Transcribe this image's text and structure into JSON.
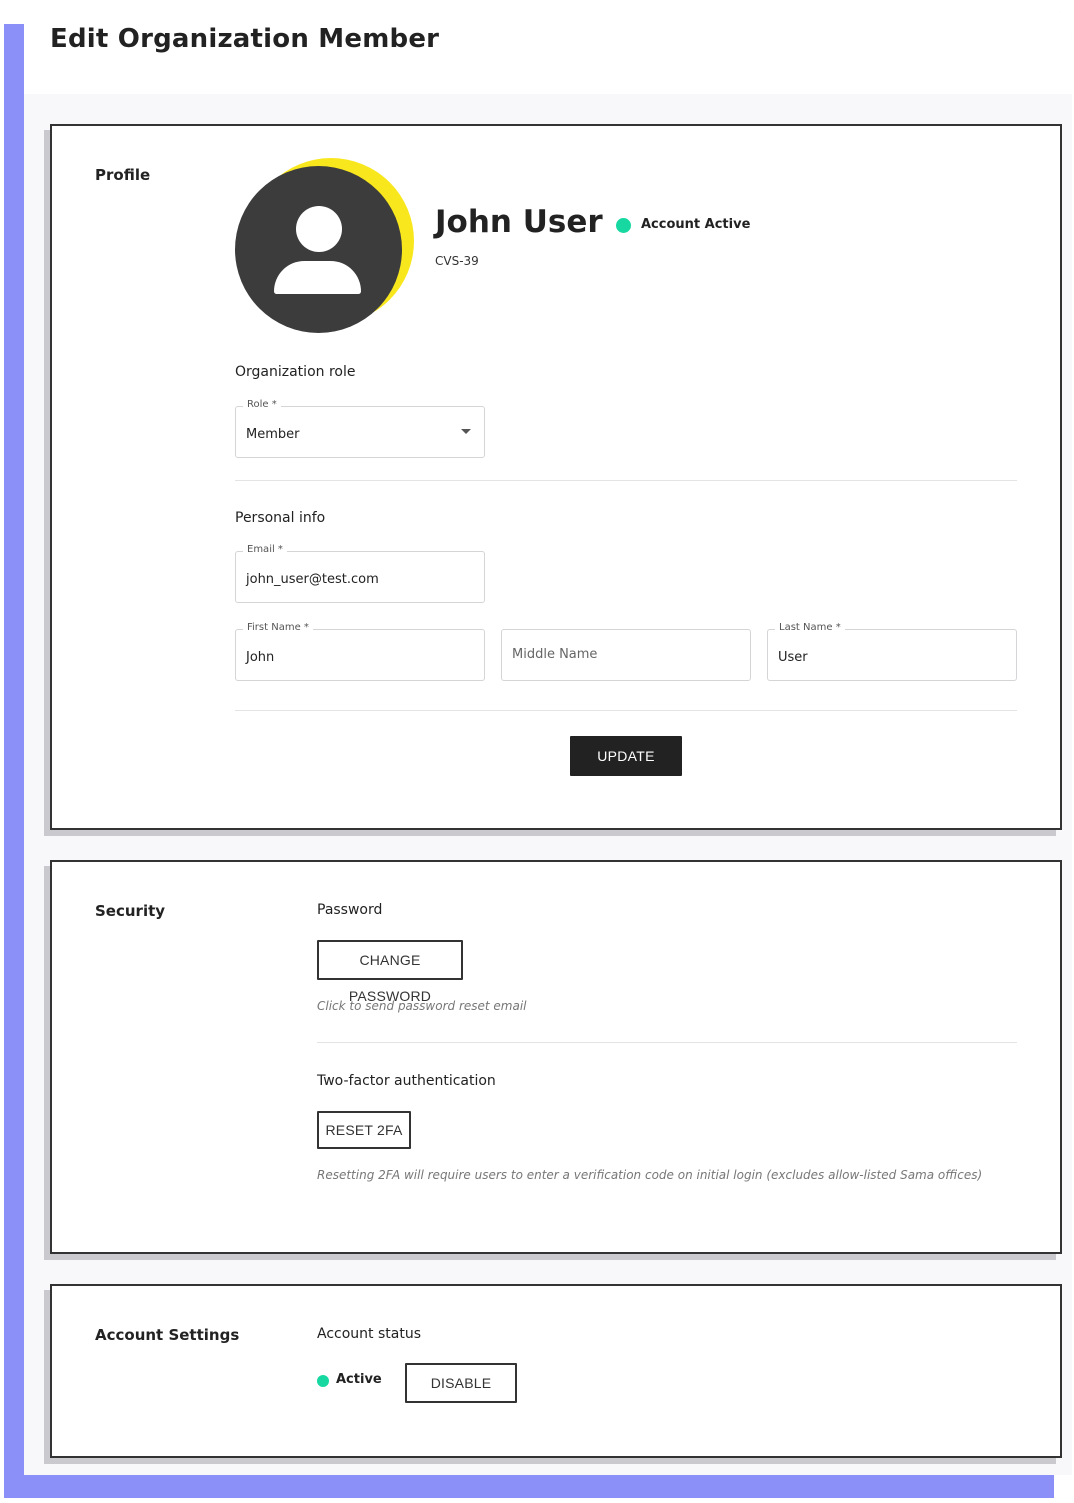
{
  "page": {
    "title": "Edit Organization Member"
  },
  "profile": {
    "section_label": "Profile",
    "name": "John User",
    "account_status": "Account Active",
    "user_id": "CVS-39",
    "org_role_title": "Organization role",
    "role": {
      "label": "Role *",
      "value": "Member"
    },
    "personal_info_title": "Personal info",
    "email": {
      "label": "Email *",
      "value": "john_user@test.com"
    },
    "first_name": {
      "label": "First Name *",
      "value": "John"
    },
    "middle_name": {
      "placeholder": "Middle Name"
    },
    "last_name": {
      "label": "Last Name *",
      "value": "User"
    },
    "update_label": "UPDATE"
  },
  "security": {
    "section_label": "Security",
    "password_title": "Password",
    "change_password_label": "CHANGE PASSWORD",
    "password_helper": "Click to send password reset email",
    "twofa_title": "Two-factor authentication",
    "reset_2fa_label": "RESET 2FA",
    "twofa_helper": "Resetting 2FA will require users to enter a verification code on initial login (excludes allow-listed Sama offices)"
  },
  "account_settings": {
    "section_label": "Account Settings",
    "status_title": "Account status",
    "status_value": "Active",
    "disable_label": "DISABLE"
  },
  "colors": {
    "status_active": "#18d8a2",
    "avatar_ring": "#f9e71e",
    "avatar_bg": "#3c3c3c",
    "primary_button": "#222222",
    "backdrop": "#8b90f8"
  }
}
